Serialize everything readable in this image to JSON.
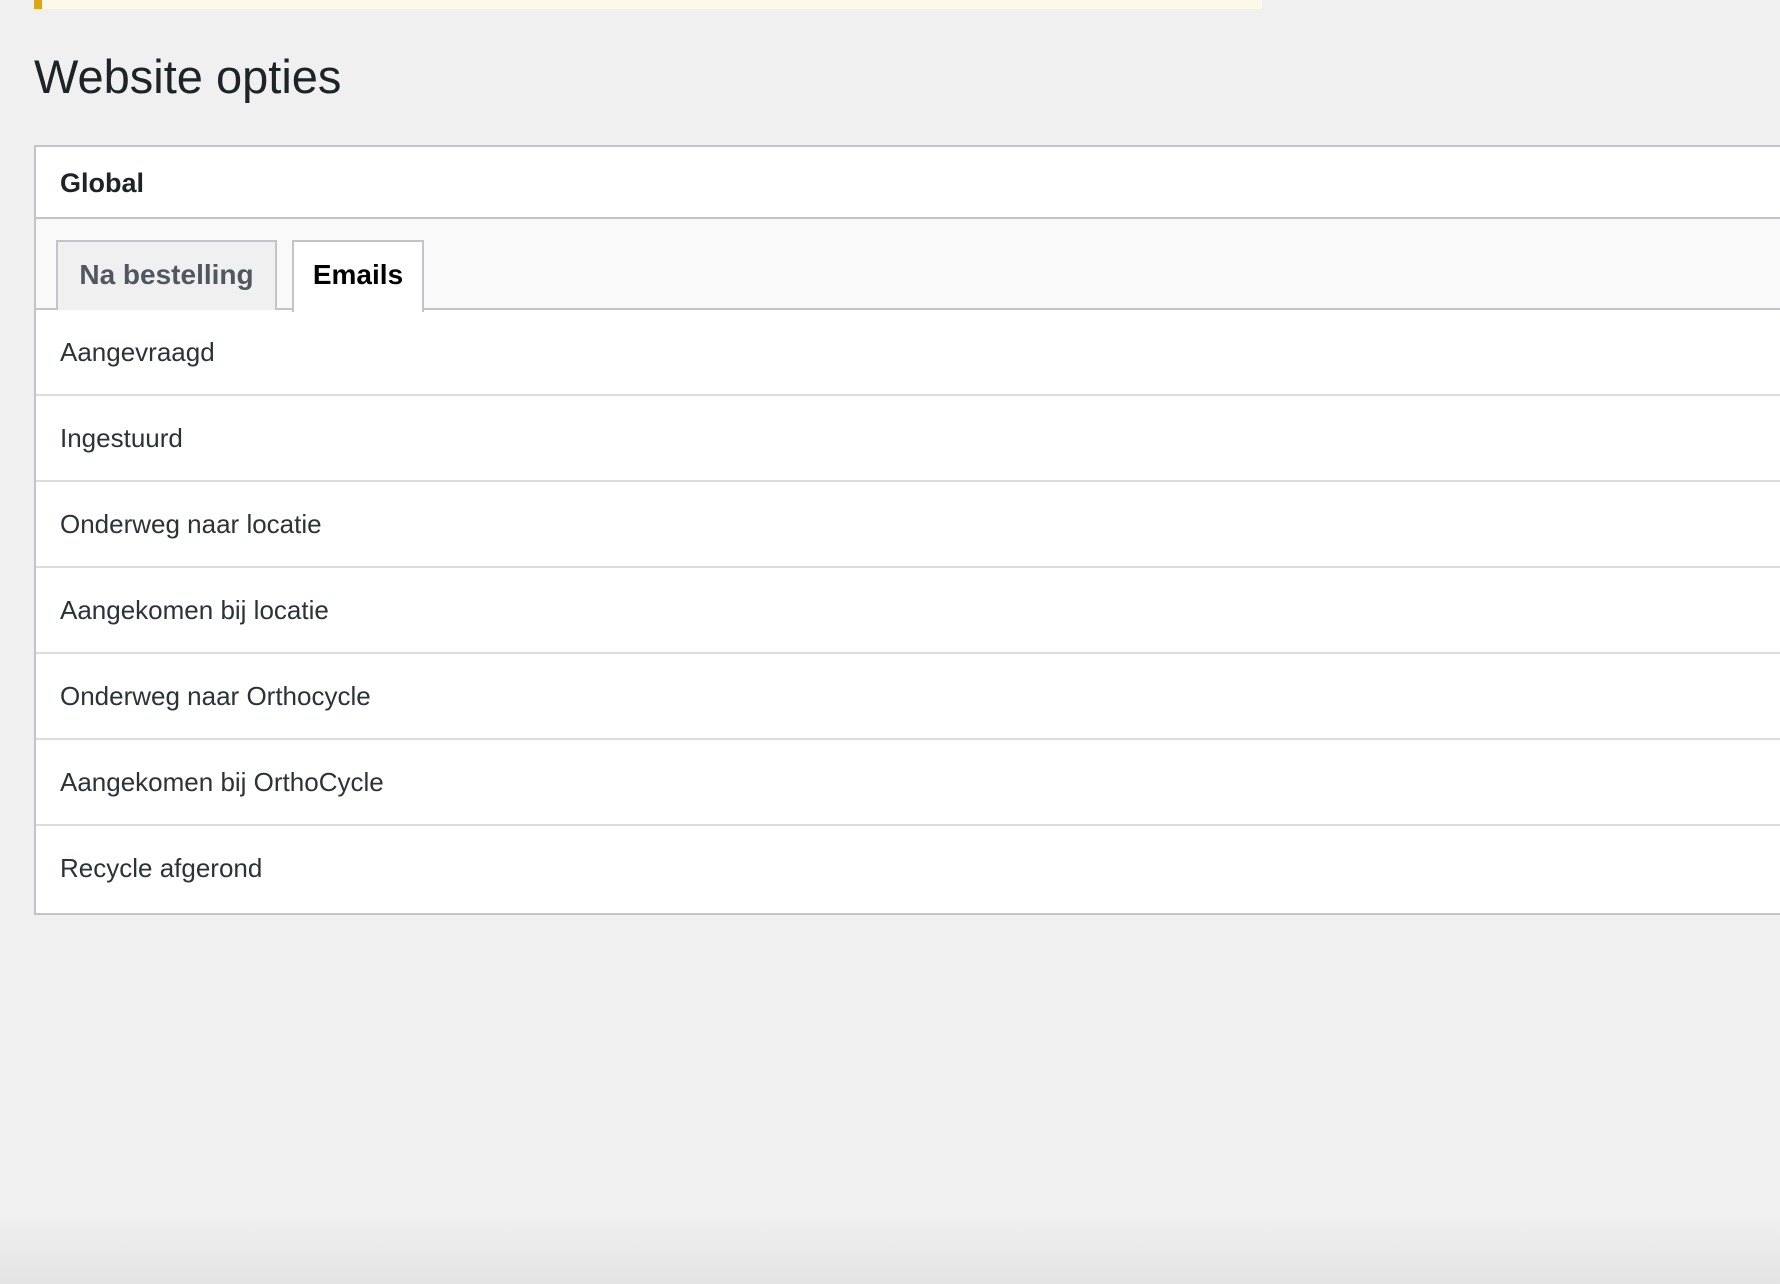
{
  "page": {
    "title": "Website opties"
  },
  "panel": {
    "title": "Global",
    "tabs": [
      {
        "label": "Na bestelling",
        "active": false
      },
      {
        "label": "Emails",
        "active": true
      }
    ],
    "rows": [
      {
        "label": "Aangevraagd"
      },
      {
        "label": "Ingestuurd"
      },
      {
        "label": "Onderweg naar locatie"
      },
      {
        "label": "Aangekomen bij locatie"
      },
      {
        "label": "Onderweg naar Orthocycle"
      },
      {
        "label": "Aangekomen bij OrthoCycle"
      },
      {
        "label": "Recycle afgerond"
      }
    ]
  },
  "colors": {
    "background": "#f0f0f1",
    "panel": "#ffffff",
    "border": "#c3c4c7",
    "notice_accent": "#dba617",
    "notice_background": "#fcf9e8",
    "text": "#1d2327"
  }
}
